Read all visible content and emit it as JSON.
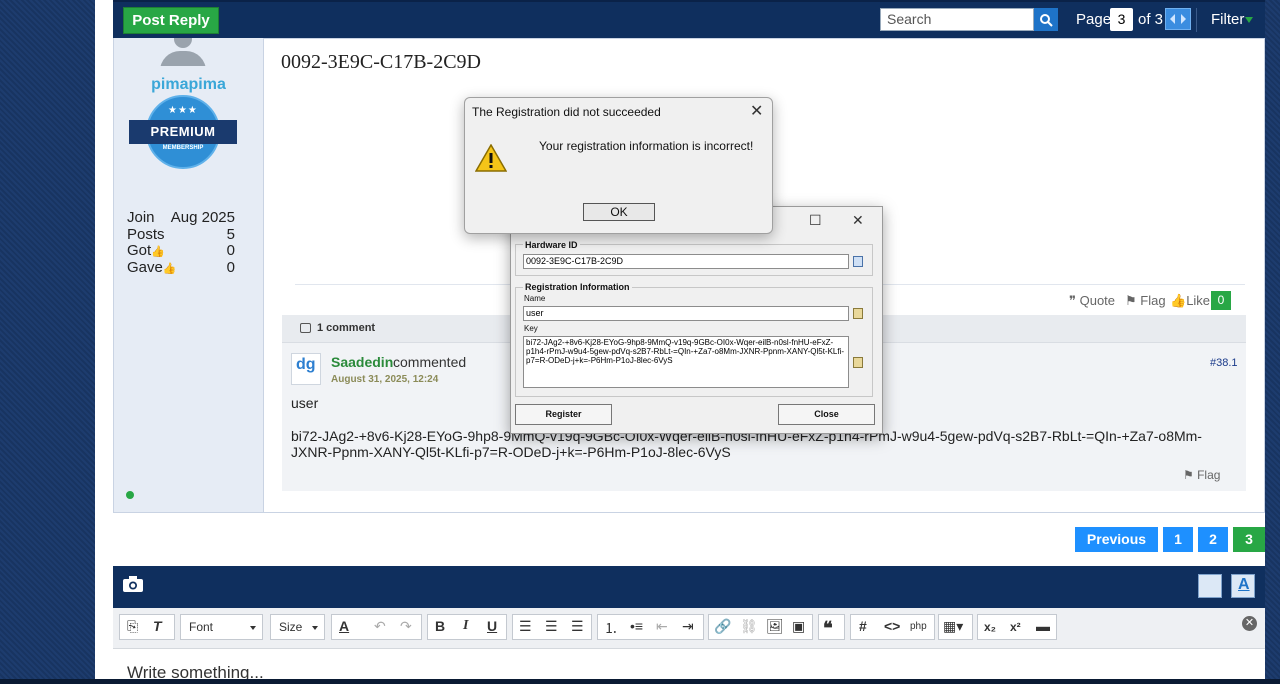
{
  "topbar": {
    "post_reply": "Post Reply",
    "search_placeholder": "Search",
    "page_label": "Page",
    "page_current": "3",
    "page_of": "of 3",
    "filter": "Filter"
  },
  "user": {
    "name": "pimapima",
    "badge_title": "PREMIUM",
    "badge_sub": "MEMBERSHIP",
    "stats": {
      "join_label": "Join",
      "join_value": "Aug 2025",
      "posts_label": "Posts",
      "posts_value": "5",
      "got_label": "Got",
      "got_value": "0",
      "gave_label": "Gave",
      "gave_value": "0"
    }
  },
  "post": {
    "title": "0092-3E9C-C17B-2C9D",
    "actions": {
      "quote": "Quote",
      "flag": "Flag",
      "like": "Like",
      "like_count": "0"
    }
  },
  "comment": {
    "header": "1 comment",
    "logo_text": "dg",
    "author": "Saadedin",
    "verb": "commented",
    "date": "August 31, 2025, 12:24",
    "number": "#38.1",
    "body_line1": "user",
    "body_line2": "bi72-JAg2-+8v6-Kj28-EYoG-9hp8-9MmQ-v19q-9GBc-OI0x-Wqer-eilB-n0sl-fnHU-eFxZ-p1h4-rPmJ-w9u4-5gew-pdVq-s2B7-RbLt-=QIn-+Za7-o8Mm-JXNR-Ppnm-XANY-Ql5t-KLfi-p7=R-ODeD-j+k=-P6Hm-P1oJ-8lec-6VyS",
    "flag": "Flag"
  },
  "pagination": {
    "previous": "Previous",
    "pages": [
      "1",
      "2",
      "3"
    ]
  },
  "editor": {
    "font_label": "Font",
    "size_label": "Size",
    "placeholder": "Write something..."
  },
  "registration_window": {
    "hardware_legend": "Hardware ID",
    "hardware_value": "0092-3E9C-C17B-2C9D",
    "reg_legend": "Registration Information",
    "name_label": "Name",
    "name_value": "user",
    "key_label": "Key",
    "key_value": "bi72-JAg2-+8v6-Kj28-EYoG-9hp8-9MmQ-v19q-9GBc-OI0x-Wqer-eilB-n0sl-fnHU-eFxZ-p1h4-rPmJ-w9u4-5gew-pdVq-s2B7-RbLt-=QIn-+Za7-o8Mm-JXNR-Ppnm-XANY-Ql5t-KLfi-p7=R-ODeD-j+k=-P6Hm-P1oJ-8lec-6VyS",
    "register_btn": "Register",
    "close_btn": "Close"
  },
  "error_dialog": {
    "title": "The Registration did not succeeded",
    "message": "Your registration information is incorrect!",
    "ok": "OK"
  },
  "colors": {
    "green": "#28a745",
    "blue": "#1e90ff",
    "navy": "#0f2f5e"
  }
}
